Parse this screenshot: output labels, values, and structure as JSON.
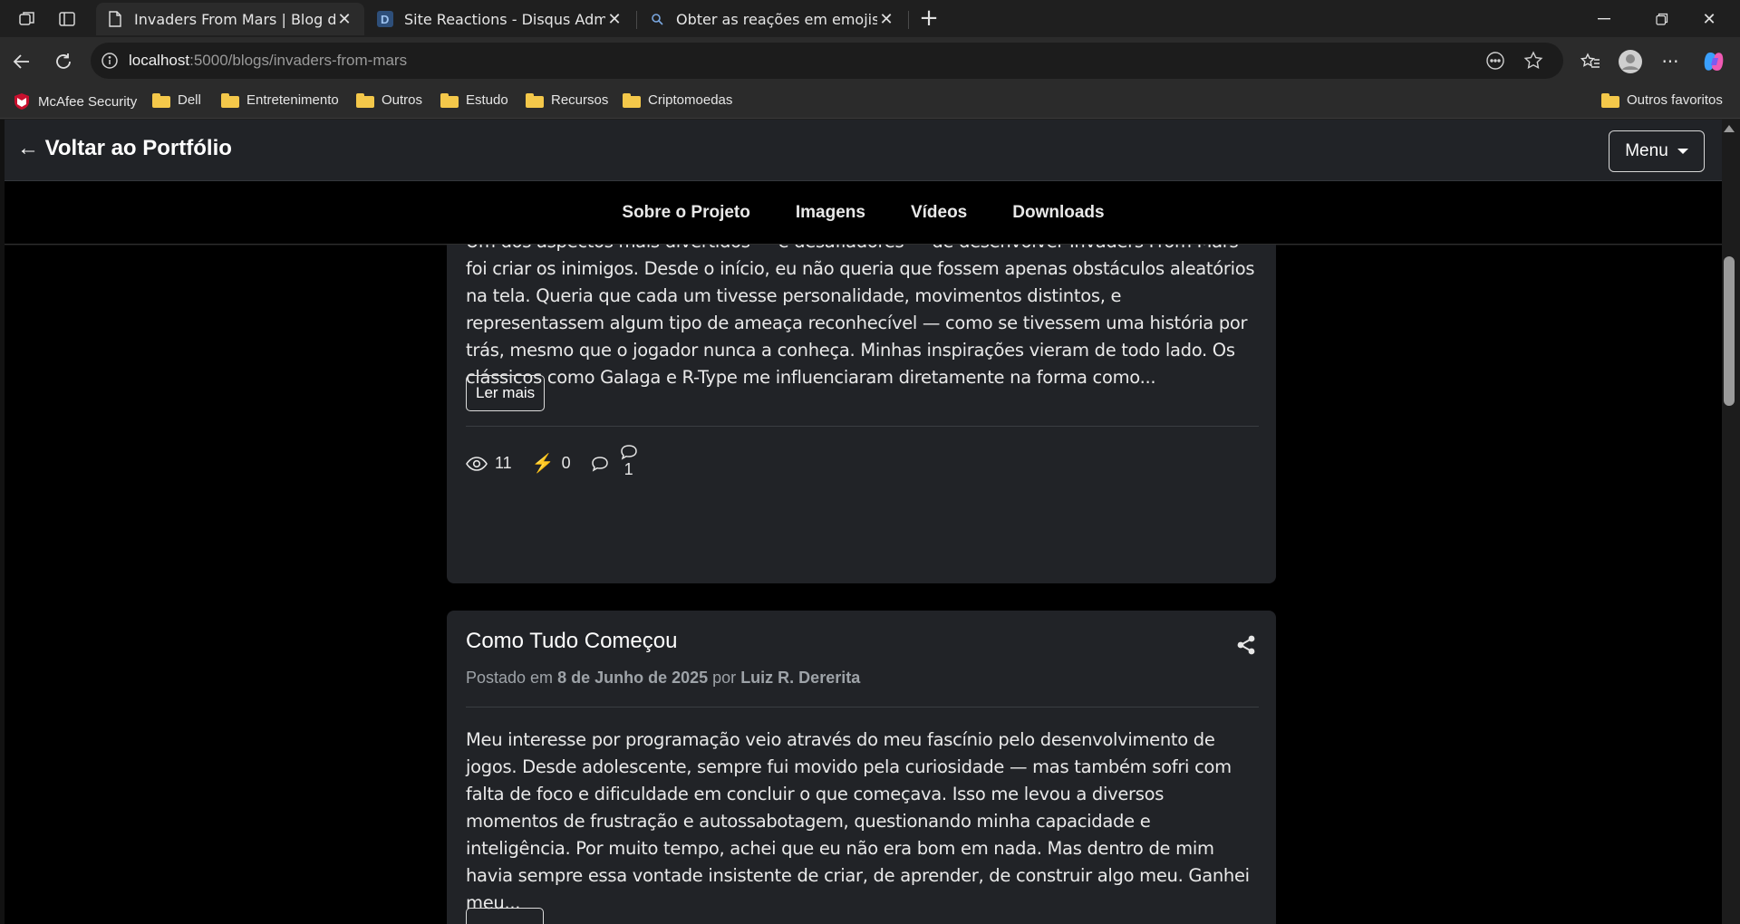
{
  "browser": {
    "tabs": [
      {
        "title": "Invaders From Mars | Blog do Proj",
        "active": true
      },
      {
        "title": "Site Reactions - Disqus Admin",
        "active": false
      },
      {
        "title": "Obter as reações em emojis do di",
        "active": false
      }
    ],
    "url_host": "localhost",
    "url_path": ":5000/blogs/invaders-from-mars",
    "bookmarks": [
      "McAfee Security",
      "Dell",
      "Entretenimento",
      "Outros",
      "Estudo",
      "Recursos",
      "Criptomoedas"
    ],
    "other_bookmarks": "Outros favoritos"
  },
  "site": {
    "back_link": "← Voltar ao Portfólio",
    "menu_label": "Menu",
    "nav": [
      "Sobre o Projeto",
      "Imagens",
      "Vídeos",
      "Downloads"
    ]
  },
  "posts": [
    {
      "excerpt": "Um dos aspectos mais divertidos — e desafiadores — de desenvolver Invaders From Mars foi criar os inimigos. Desde o início, eu não queria que fossem apenas obstáculos aleatórios na tela. Queria que cada um tivesse personalidade, movimentos distintos, e representassem algum tipo de ameaça reconhecível — como se tivessem uma história por trás, mesmo que o jogador nunca a conheça. Minhas inspirações vieram de todo lado. Os clássicos como Galaga e R-Type me influenciaram diretamente na forma como...",
      "read_more": "Ler mais",
      "views": "11",
      "reactions": "0",
      "comments": "1"
    },
    {
      "title": "Como Tudo Começou",
      "meta_prefix": "Postado em",
      "date": "8 de Junho de 2025",
      "meta_by": "por",
      "author": "Luiz R. Dererita",
      "excerpt": "Meu interesse por programação veio através do meu fascínio pelo desenvolvimento de jogos. Desde adolescente, sempre fui movido pela curiosidade — mas também sofri com falta de foco e dificuldade em concluir o que começava. Isso me levou a diversos momentos de frustração e autossabotagem, questionando minha capacidade e inteligência. Por muito tempo, achei que eu não era bom em nada. Mas dentro de mim havia sempre essa vontade insistente de criar, de aprender, de construir algo meu. Ganhei meu..."
    }
  ]
}
